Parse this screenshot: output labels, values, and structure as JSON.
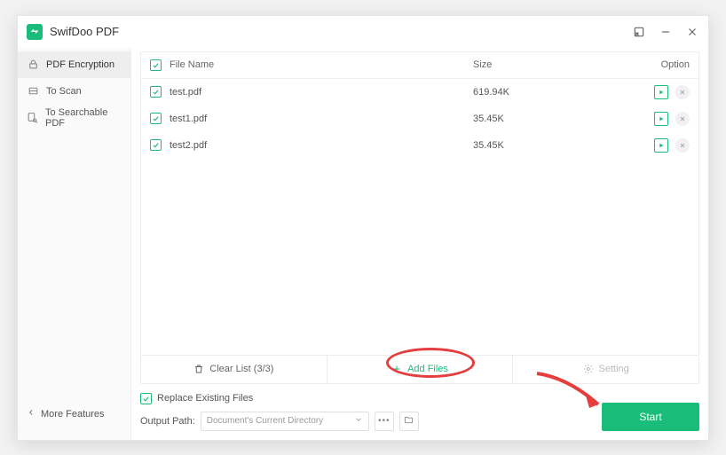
{
  "app": {
    "title": "SwifDoo PDF"
  },
  "sidebar": {
    "items": [
      {
        "label": "PDF Encryption"
      },
      {
        "label": "To Scan"
      },
      {
        "label": "To Searchable PDF"
      }
    ],
    "more": "More Features"
  },
  "table": {
    "headers": {
      "name": "File Name",
      "size": "Size",
      "option": "Option"
    },
    "rows": [
      {
        "name": "test.pdf",
        "size": "619.94K"
      },
      {
        "name": "test1.pdf",
        "size": "35.45K"
      },
      {
        "name": "test2.pdf",
        "size": "35.45K"
      }
    ]
  },
  "actions": {
    "clear": "Clear List (3/3)",
    "add": "Add Files",
    "setting": "Setting"
  },
  "bottom": {
    "replace": "Replace Existing Files",
    "outputLabel": "Output Path:",
    "outputValue": "Document's Current Directory",
    "start": "Start"
  }
}
